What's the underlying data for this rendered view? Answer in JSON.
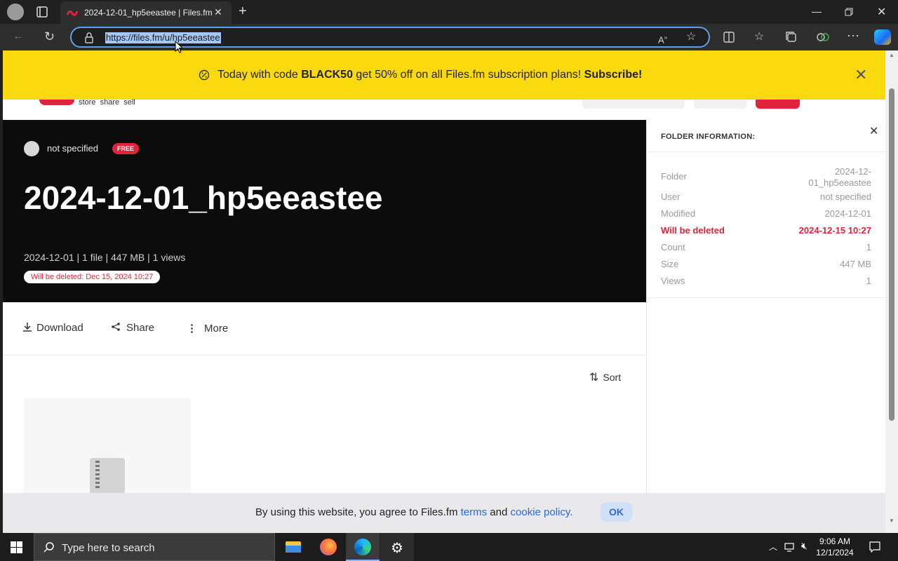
{
  "browser": {
    "tab_title": "2024-12-01_hp5eeastee | Files.fm",
    "url": "https://files.fm/u/hp5eeastee"
  },
  "promo": {
    "prefix": "Today with code ",
    "code": "BLACK50",
    "middle": " get 50% off on all Files.fm subscription plans! ",
    "cta": "Subscribe!"
  },
  "logo": {
    "tagline": "store  share  sell"
  },
  "folder": {
    "owner": "not specified",
    "badge": "FREE",
    "title": "2024-12-01_hp5eeastee",
    "meta": "2024-12-01 | 1 file | 447 MB | 1 views",
    "delete_notice": "Will be deleted: Dec 15, 2024 10:27"
  },
  "actions": {
    "download": "Download",
    "share": "Share",
    "more": "More",
    "sort": "Sort"
  },
  "info_panel": {
    "heading": "FOLDER INFORMATION:",
    "rows": [
      {
        "label": "Folder",
        "value": "2024-12-\n01_hp5eeastee"
      },
      {
        "label": "User",
        "value": "not specified"
      },
      {
        "label": "Modified",
        "value": "2024-12-01"
      },
      {
        "label": "Will be deleted",
        "value": "2024-12-15 10:27"
      },
      {
        "label": "Count",
        "value": "1"
      },
      {
        "label": "Size",
        "value": "447 MB"
      },
      {
        "label": "Views",
        "value": "1"
      }
    ]
  },
  "cookie": {
    "prefix": "By using this website, you agree to Files.fm ",
    "terms": "terms",
    "and": " and ",
    "policy": "cookie policy.",
    "ok": "OK"
  },
  "taskbar": {
    "search_placeholder": "Type here to search",
    "time": "9:06 AM",
    "date": "12/1/2024"
  },
  "colors": {
    "promo": "#fbd90f",
    "accent_red": "#e0223c",
    "hero_bg": "#0c0c0d",
    "link": "#2d6ad9"
  }
}
